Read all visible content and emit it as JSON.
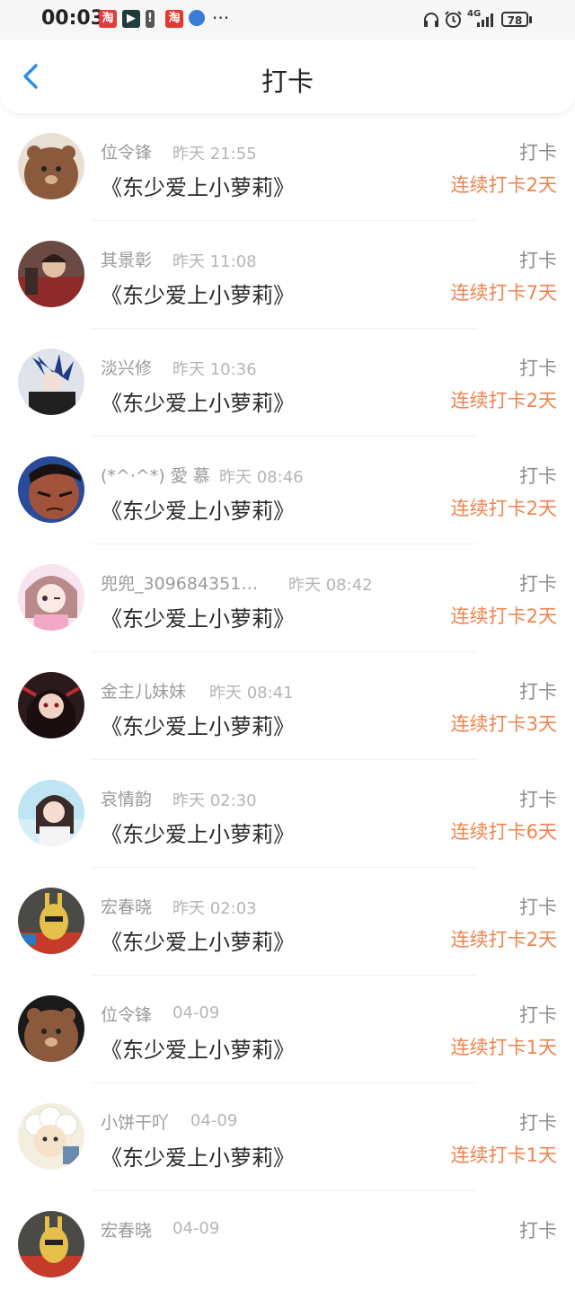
{
  "status_bar": {
    "time": "00:03",
    "network": "4G",
    "battery": "78"
  },
  "header": {
    "title": "打卡"
  },
  "items": [
    {
      "name": "位令锋",
      "time": "昨天 21:55",
      "book": "《东少爱上小萝莉》",
      "action": "打卡",
      "streak": "连续打卡2天"
    },
    {
      "name": "其景彰",
      "time": "昨天 11:08",
      "book": "《东少爱上小萝莉》",
      "action": "打卡",
      "streak": "连续打卡7天"
    },
    {
      "name": "淡兴修",
      "time": "昨天 10:36",
      "book": "《东少爱上小萝莉》",
      "action": "打卡",
      "streak": "连续打卡2天"
    },
    {
      "name": "(*^·^*) 愛 慕",
      "time": "昨天 08:46",
      "book": "《东少爱上小萝莉》",
      "action": "打卡",
      "streak": "连续打卡2天"
    },
    {
      "name": "兜兜_309684351…",
      "time": "昨天 08:42",
      "book": "《东少爱上小萝莉》",
      "action": "打卡",
      "streak": "连续打卡2天"
    },
    {
      "name": "金主儿妹妹",
      "time": "昨天 08:41",
      "book": "《东少爱上小萝莉》",
      "action": "打卡",
      "streak": "连续打卡3天"
    },
    {
      "name": "哀情韵",
      "time": "昨天 02:30",
      "book": "《东少爱上小萝莉》",
      "action": "打卡",
      "streak": "连续打卡6天"
    },
    {
      "name": "宏春晓",
      "time": "昨天 02:03",
      "book": "《东少爱上小萝莉》",
      "action": "打卡",
      "streak": "连续打卡2天"
    },
    {
      "name": "位令锋",
      "time": "04-09",
      "book": "《东少爱上小萝莉》",
      "action": "打卡",
      "streak": "连续打卡1天"
    },
    {
      "name": "小饼干吖",
      "time": "04-09",
      "book": "《东少爱上小萝莉》",
      "action": "打卡",
      "streak": "连续打卡1天"
    },
    {
      "name": "宏春晓",
      "time": "04-09",
      "book": "",
      "action": "打卡",
      "streak": ""
    }
  ],
  "colors": {
    "accent": "#2f8de4",
    "streak": "#f0834e"
  }
}
